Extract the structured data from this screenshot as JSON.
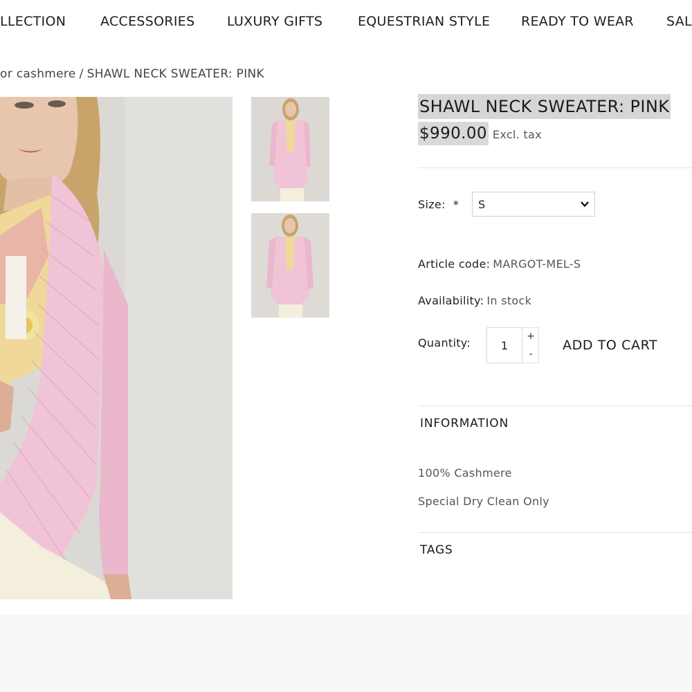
{
  "nav": {
    "items": [
      "LLECTION",
      "ACCESSORIES",
      "LUXURY GIFTS",
      "EQUESTRIAN STYLE",
      "READY TO WEAR",
      "SALI"
    ]
  },
  "breadcrumb": {
    "parent": "or cashmere",
    "separator": "/",
    "current": "SHAWL NECK SWEATER: PINK"
  },
  "product": {
    "title": "SHAWL NECK SWEATER: PINK",
    "price": "$990.00",
    "tax_note": "Excl. tax",
    "size_label": "Size:",
    "required_mark": "*",
    "size_value": "S",
    "article_label": "Article code:",
    "article_value": "MARGOT-MEL-S",
    "availability_label": "Availability:",
    "availability_value": "In stock",
    "quantity_label": "Quantity:",
    "quantity_value": "1",
    "plus": "+",
    "minus": "-",
    "add_to_cart": "ADD TO CART"
  },
  "info": {
    "heading": "INFORMATION",
    "lines": [
      "100% Cashmere",
      "Special Dry Clean Only"
    ]
  },
  "tags": {
    "heading": "TAGS"
  },
  "colors": {
    "sweater": "#f0c4d6",
    "highlight": "#d6d6d6",
    "footer": "#f7f7f7"
  }
}
